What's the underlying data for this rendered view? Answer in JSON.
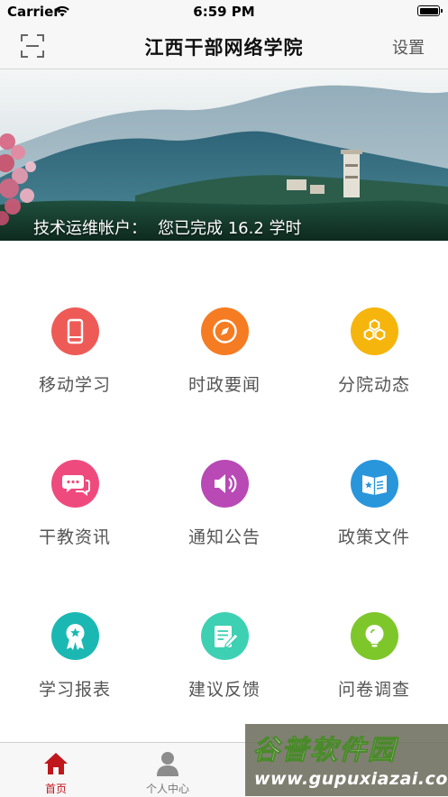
{
  "status_bar": {
    "carrier": "Carrier",
    "time": "6:59 PM"
  },
  "nav": {
    "title": "江西干部网络学院",
    "settings_label": "设置",
    "scan_icon": "scan-icon"
  },
  "banner": {
    "caption_label": "技术运维帐户：",
    "caption_value": "您已完成 16.2 学时"
  },
  "grid": {
    "items": [
      {
        "label": "移动学习",
        "icon": "mobile-phone-icon",
        "color": "#ee5b57"
      },
      {
        "label": "时政要闻",
        "icon": "compass-icon",
        "color": "#f57c22"
      },
      {
        "label": "分院动态",
        "icon": "hexagons-icon",
        "color": "#f5b50c"
      },
      {
        "label": "干教资讯",
        "icon": "chat-bubbles-icon",
        "color": "#ef4a7e"
      },
      {
        "label": "通知公告",
        "icon": "speaker-icon",
        "color": "#b849b5"
      },
      {
        "label": "政策文件",
        "icon": "document-star-icon",
        "color": "#2996dc"
      },
      {
        "label": "学习报表",
        "icon": "award-ribbon-icon",
        "color": "#1bb8b3"
      },
      {
        "label": "建议反馈",
        "icon": "edit-note-icon",
        "color": "#3ed0b2"
      },
      {
        "label": "问卷调查",
        "icon": "lightbulb-icon",
        "color": "#7ec72b"
      }
    ]
  },
  "tabs": [
    {
      "label": "首页",
      "icon": "home-icon",
      "active": true
    },
    {
      "label": "个人中心",
      "icon": "person-icon",
      "active": false
    }
  ],
  "colors": {
    "accent": "#c0171d",
    "inactive": "#888888"
  },
  "watermark": {
    "title": "谷普软件园",
    "url": "www.gupuxiazai.com"
  }
}
